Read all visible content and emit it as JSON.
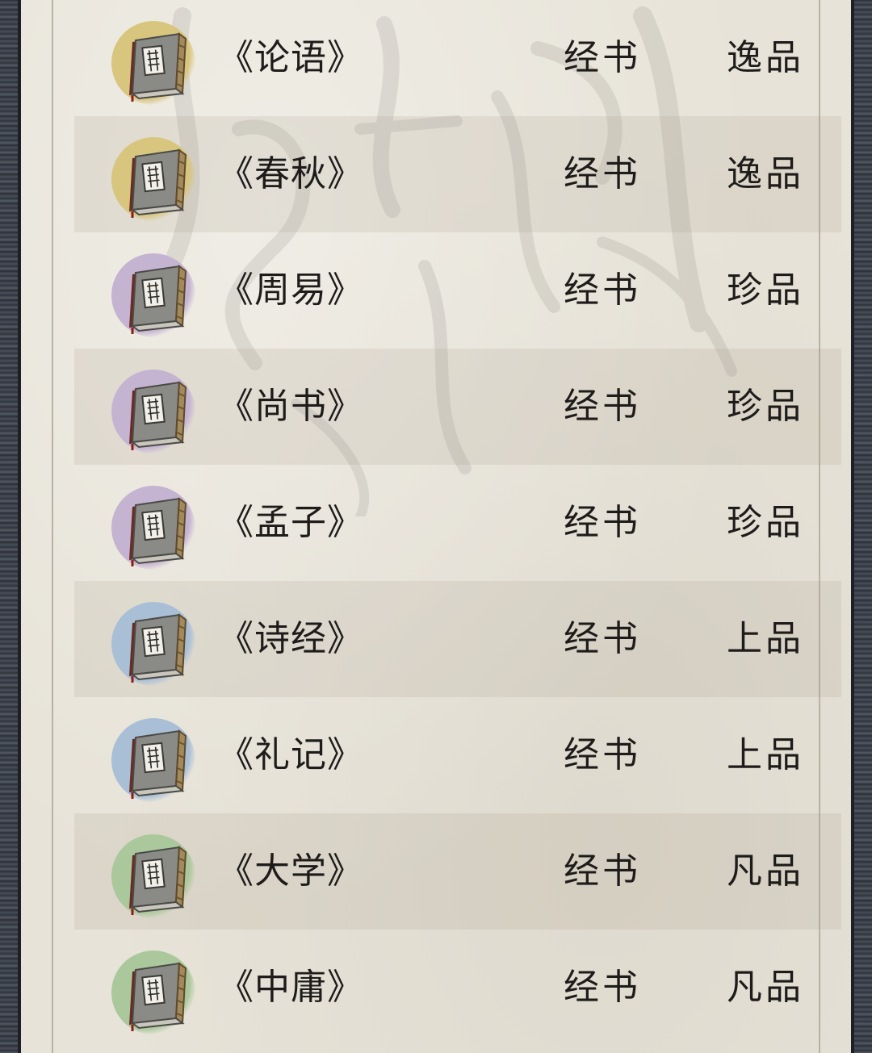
{
  "grade_colors": {
    "逸品": "#d8c57e",
    "珍品": "#c5b3d2",
    "上品": "#a9bfd6",
    "凡品": "#aac89b"
  },
  "books": [
    {
      "name": "《论语》",
      "type": "经书",
      "grade": "逸品",
      "icon": "book-icon"
    },
    {
      "name": "《春秋》",
      "type": "经书",
      "grade": "逸品",
      "icon": "book-icon"
    },
    {
      "name": "《周易》",
      "type": "经书",
      "grade": "珍品",
      "icon": "book-icon"
    },
    {
      "name": "《尚书》",
      "type": "经书",
      "grade": "珍品",
      "icon": "book-icon"
    },
    {
      "name": "《孟子》",
      "type": "经书",
      "grade": "珍品",
      "icon": "book-icon"
    },
    {
      "name": "《诗经》",
      "type": "经书",
      "grade": "上品",
      "icon": "book-icon"
    },
    {
      "name": "《礼记》",
      "type": "经书",
      "grade": "上品",
      "icon": "book-icon"
    },
    {
      "name": "《大学》",
      "type": "经书",
      "grade": "凡品",
      "icon": "book-icon"
    },
    {
      "name": "《中庸》",
      "type": "经书",
      "grade": "凡品",
      "icon": "book-icon"
    }
  ]
}
